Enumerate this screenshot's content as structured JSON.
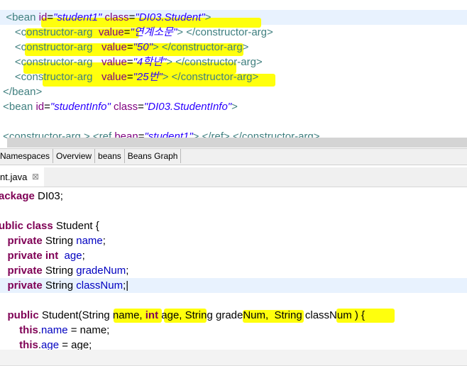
{
  "colors": {
    "tag": "#3f7f7f",
    "attr": "#7f007f",
    "value": "#2a00ff",
    "keyword": "#7f0055",
    "field": "#0000c0",
    "highlight": "#ffff00",
    "current_line": "#e8f2fe"
  },
  "xml_lines": [
    [
      {
        "t": "  <bean ",
        "c": "tag"
      },
      {
        "t": "id",
        "c": "attr"
      },
      {
        "t": "=",
        "c": "pl"
      },
      {
        "t": "\"student1\"",
        "c": "val"
      },
      {
        "t": " class",
        "c": "attr"
      },
      {
        "t": "=",
        "c": "pl"
      },
      {
        "t": "\"DI03.Student\"",
        "c": "val"
      },
      {
        "t": ">",
        "c": "tag"
      }
    ],
    [
      {
        "t": "     <constructor-arg  ",
        "c": "tag"
      },
      {
        "t": "value",
        "c": "attr"
      },
      {
        "t": "=",
        "c": "pl"
      },
      {
        "t": "\"연계소문\"",
        "c": "val"
      },
      {
        "t": "> </constructor-arg>",
        "c": "tag"
      }
    ],
    [
      {
        "t": "     <constructor-arg   ",
        "c": "tag"
      },
      {
        "t": "value",
        "c": "attr"
      },
      {
        "t": "=",
        "c": "pl"
      },
      {
        "t": "\"50\"",
        "c": "val"
      },
      {
        "t": "> </constructor-arg>",
        "c": "tag"
      }
    ],
    [
      {
        "t": "     <constructor-arg   ",
        "c": "tag"
      },
      {
        "t": "value",
        "c": "attr"
      },
      {
        "t": "=",
        "c": "pl"
      },
      {
        "t": "\"4학년\"",
        "c": "val"
      },
      {
        "t": "> </constructor-arg>",
        "c": "tag"
      }
    ],
    [
      {
        "t": "     <constructor-arg   ",
        "c": "tag"
      },
      {
        "t": "value",
        "c": "attr"
      },
      {
        "t": "=",
        "c": "pl"
      },
      {
        "t": "\"25번\"",
        "c": "val"
      },
      {
        "t": "> </constructor-arg>",
        "c": "tag"
      }
    ],
    [
      {
        "t": " </bean>",
        "c": "tag"
      }
    ],
    [
      {
        "t": " <bean ",
        "c": "tag"
      },
      {
        "t": "id",
        "c": "attr"
      },
      {
        "t": "=",
        "c": "pl"
      },
      {
        "t": "\"studentInfo\"",
        "c": "val"
      },
      {
        "t": " class",
        "c": "attr"
      },
      {
        "t": "=",
        "c": "pl"
      },
      {
        "t": "\"DI03.StudentInfo\"",
        "c": "val"
      },
      {
        "t": ">",
        "c": "tag"
      }
    ],
    [],
    [
      {
        "t": " <constructor-arg > <ref ",
        "c": "tag"
      },
      {
        "t": "bean",
        "c": "attr"
      },
      {
        "t": "=",
        "c": "pl"
      },
      {
        "t": "\"student1\"",
        "c": "val"
      },
      {
        "t": "> </ref> </constructor-arg>",
        "c": "tag"
      }
    ]
  ],
  "design_tabs": [
    "Namespaces",
    "Overview",
    "beans",
    "Beans Graph"
  ],
  "editor_tab": {
    "label": "nt.java",
    "close": "⊠"
  },
  "java_lines": [
    [
      {
        "t": "ackage",
        "c": "kw"
      },
      {
        "t": " DI03;",
        "c": "pl"
      }
    ],
    [],
    [
      {
        "t": "ublic class",
        "c": "kw"
      },
      {
        "t": " Student {",
        "c": "pl"
      }
    ],
    [
      {
        "t": "   private",
        "c": "kw"
      },
      {
        "t": " String ",
        "c": "pl"
      },
      {
        "t": "name",
        "c": "fld"
      },
      {
        "t": ";",
        "c": "pl"
      }
    ],
    [
      {
        "t": "   private int",
        "c": "kw"
      },
      {
        "t": "  ",
        "c": "pl"
      },
      {
        "t": "age",
        "c": "fld"
      },
      {
        "t": ";",
        "c": "pl"
      }
    ],
    [
      {
        "t": "   private",
        "c": "kw"
      },
      {
        "t": " String ",
        "c": "pl"
      },
      {
        "t": "gradeNum",
        "c": "fld"
      },
      {
        "t": ";",
        "c": "pl"
      }
    ],
    [
      {
        "t": "   private",
        "c": "kw"
      },
      {
        "t": " String ",
        "c": "pl"
      },
      {
        "t": "classNum",
        "c": "fld"
      },
      {
        "t": ";|",
        "c": "pl"
      }
    ],
    [],
    [
      {
        "t": "   public",
        "c": "kw"
      },
      {
        "t": " Student(String name, ",
        "c": "pl"
      },
      {
        "t": "int",
        "c": "kw"
      },
      {
        "t": " age, String gradeNum,  String classNum ) {",
        "c": "pl"
      }
    ],
    [
      {
        "t": "       this",
        "c": "kw"
      },
      {
        "t": ".",
        "c": "pl"
      },
      {
        "t": "name",
        "c": "fld"
      },
      {
        "t": " = name;",
        "c": "pl"
      }
    ],
    [
      {
        "t": "       this",
        "c": "kw"
      },
      {
        "t": ".",
        "c": "pl"
      },
      {
        "t": "age",
        "c": "fld"
      },
      {
        "t": " = age;",
        "c": "pl"
      }
    ]
  ]
}
